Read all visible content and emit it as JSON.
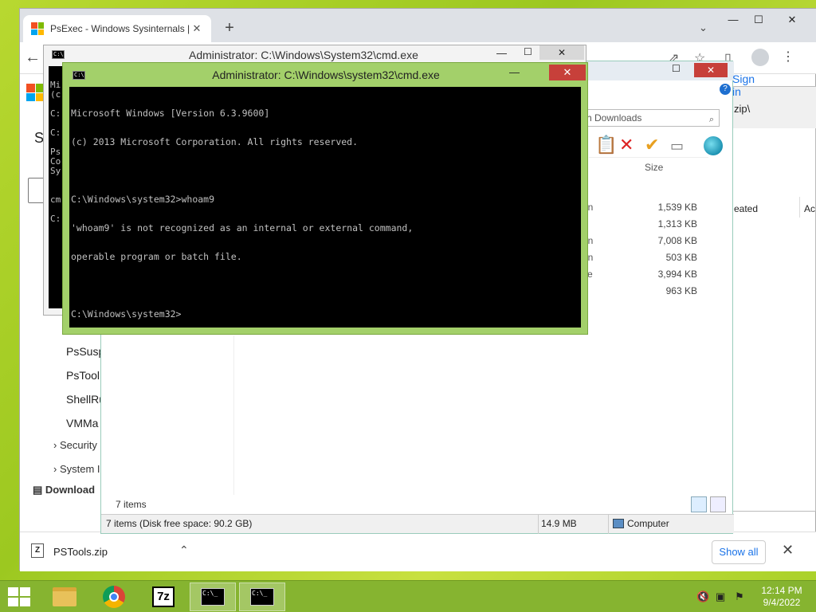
{
  "chrome": {
    "tab_title": "PsExec - Windows Sysinternals | M",
    "tab_close": "✕",
    "new_tab": "+",
    "tab_menu": "⌄",
    "minimize": "—",
    "maximize": "☐",
    "close": "✕",
    "back": "←",
    "page_partial_s": "S",
    "sign_in_partial": "Sign in",
    "nav_items": [
      "PsSusp",
      "PsTool",
      "ShellRu",
      "VMMa"
    ],
    "nav_groups": [
      "Security U",
      "System In"
    ],
    "downloads_partial": "Download",
    "download_file": "PSTools.zip",
    "download_chevron": "⌃",
    "show_all": "Show all",
    "download_close": "✕"
  },
  "explorer": {
    "search_placeholder": "h Downloads",
    "column_size": "Size",
    "files": [
      {
        "type": "on",
        "size": "1,539 KB"
      },
      {
        "type": "e",
        "size": "1,313 KB"
      },
      {
        "type": "on",
        "size": "7,008 KB"
      },
      {
        "type": "on",
        "size": "503 KB"
      },
      {
        "type": "ve",
        "size": "3,994 KB"
      },
      {
        "type": "e",
        "size": "963 KB"
      }
    ],
    "items_count": "7 items",
    "status_left": "7 items (Disk free space: 90.2 GB)",
    "status_mid": "14.9 MB",
    "status_right": "Computer"
  },
  "right_window": {
    "path_partial": "zip\\",
    "col_created": "eated",
    "col_ac": "Ac"
  },
  "cmd_back": {
    "title": "Administrator: C:\\Windows\\System32\\cmd.exe",
    "partial_lines": [
      "Mi",
      "(c",
      "",
      "C:",
      "",
      "C:",
      "",
      "Ps",
      "Co",
      "Sy",
      "",
      "",
      "cm",
      "",
      "C:"
    ]
  },
  "cmd_front": {
    "title": "Administrator: C:\\Windows\\system32\\cmd.exe",
    "minimize": "—",
    "close": "✕",
    "lines": [
      "Microsoft Windows [Version 6.3.9600]",
      "(c) 2013 Microsoft Corporation. All rights reserved.",
      "",
      "C:\\Windows\\system32>whoam9",
      "'whoam9' is not recognized as an internal or external command,",
      "operable program or batch file.",
      "",
      "C:\\Windows\\system32>"
    ]
  },
  "taskbar": {
    "sevenzip_label": "7z",
    "cmd_icon_text": "C:\\_",
    "time": "12:14 PM",
    "date": "9/4/2022"
  },
  "colors": {
    "ms_red": "#f25022",
    "ms_green": "#7fba00",
    "ms_blue": "#00a4ef",
    "ms_yellow": "#ffb900",
    "cmd_title_green": "#a3d06a",
    "close_red": "#c7403a",
    "taskbar_green": "#86b430"
  }
}
